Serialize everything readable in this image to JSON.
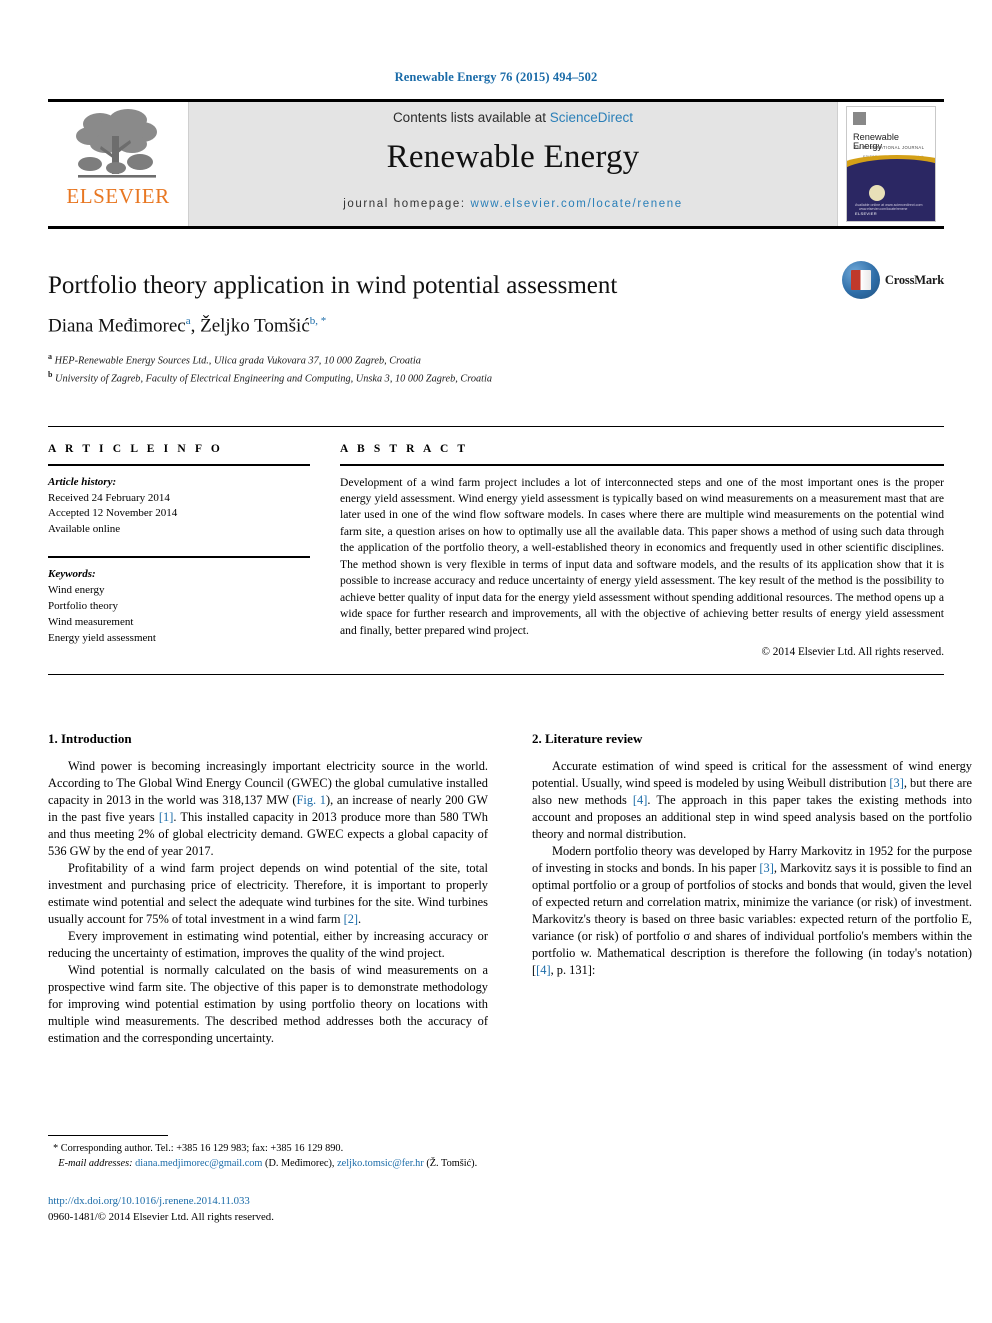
{
  "running_head": "Renewable Energy 76 (2015) 494–502",
  "masthead": {
    "publisher_name": "ELSEVIER",
    "contents_prefix": "Contents lists available at ",
    "contents_link": "ScienceDirect",
    "journal_name": "Renewable Energy",
    "homepage_prefix": "journal homepage: ",
    "homepage_url": "www.elsevier.com/locate/renene",
    "cover": {
      "title": "Renewable Energy",
      "subtitle": "AN INTERNATIONAL JOURNAL",
      "subtitle2": "EDITOR-IN-CHIEF: A.A.M. Sayigh",
      "footer": "ELSEVIER",
      "footer2": "Available online at www.sciencedirect.com",
      "mid": "www.elsevier.com/locate/renene"
    }
  },
  "article": {
    "title": "Portfolio theory application in wind potential assessment",
    "authors": [
      {
        "name": "Diana Međimorec",
        "marks": "a"
      },
      {
        "name": "Željko Tomšić",
        "marks": "b, *"
      }
    ],
    "authors_line_sep": ", ",
    "affiliations": [
      {
        "mark": "a",
        "text": "HEP-Renewable Energy Sources Ltd., Ulica grada Vukovara 37, 10 000 Zagreb, Croatia"
      },
      {
        "mark": "b",
        "text": "University of Zagreb, Faculty of Electrical Engineering and Computing, Unska 3, 10 000 Zagreb, Croatia"
      }
    ],
    "crossmark_label": "CrossMark"
  },
  "info": {
    "heading": "A R T I C L E   I N F O",
    "history_label": "Article history:",
    "history": [
      "Received 24 February 2014",
      "Accepted 12 November 2014",
      "Available online"
    ],
    "keywords_label": "Keywords:",
    "keywords": [
      "Wind energy",
      "Portfolio theory",
      "Wind measurement",
      "Energy yield assessment"
    ]
  },
  "abstract": {
    "heading": "A B S T R A C T",
    "text": "Development of a wind farm project includes a lot of interconnected steps and one of the most important ones is the proper energy yield assessment. Wind energy yield assessment is typically based on wind measurements on a measurement mast that are later used in one of the wind flow software models. In cases where there are multiple wind measurements on the potential wind farm site, a question arises on how to optimally use all the available data. This paper shows a method of using such data through the application of the portfolio theory, a well-established theory in economics and frequently used in other scientific disciplines. The method shown is very flexible in terms of input data and software models, and the results of its application show that it is possible to increase accuracy and reduce uncertainty of energy yield assessment. The key result of the method is the possibility to achieve better quality of input data for the energy yield assessment without spending additional resources. The method opens up a wide space for further research and improvements, all with the objective of achieving better results of energy yield assessment and finally, better prepared wind project.",
    "copyright": "© 2014 Elsevier Ltd. All rights reserved."
  },
  "sections": {
    "intro": {
      "heading": "1. Introduction",
      "p1_a": "Wind power is becoming increasingly important electricity source in the world. According to The Global Wind Energy Council (GWEC) the global cumulative installed capacity in 2013 in the world was 318,137 MW (",
      "p1_fig": "Fig. 1",
      "p1_b": "), an increase of nearly 200 GW in the past five years ",
      "p1_ref1": "[1]",
      "p1_c": ". This installed capacity in 2013 produce more than 580 TWh and thus meeting 2% of global electricity demand. GWEC expects a global capacity of 536 GW by the end of year 2017.",
      "p2_a": "Profitability of a wind farm project depends on wind potential of the site, total investment and purchasing price of electricity. Therefore, it is important to properly estimate wind potential and select the adequate wind turbines for the site. Wind turbines usually account for 75% of total investment in a wind farm ",
      "p2_ref": "[2]",
      "p2_b": ".",
      "p3": "Every improvement in estimating wind potential, either by increasing accuracy or reducing the uncertainty of estimation, improves the quality of the wind project.",
      "p4": "Wind potential is normally calculated on the basis of wind measurements on a prospective wind farm site. The objective of this paper is to demonstrate methodology for improving wind potential estimation by using portfolio theory on locations with multiple wind measurements. The described method addresses both the accuracy of estimation and the corresponding uncertainty."
    },
    "literature": {
      "heading": "2. Literature review",
      "p1_a": "Accurate estimation of wind speed is critical for the assessment of wind energy potential. Usually, wind speed is modeled by using Weibull distribution ",
      "p1_ref1": "[3]",
      "p1_b": ", but there are also new methods ",
      "p1_ref2": "[4]",
      "p1_c": ". The approach in this paper takes the existing methods into account and proposes an additional step in wind speed analysis based on the portfolio theory and normal distribution.",
      "p2_a": "Modern portfolio theory was developed by Harry Markovitz in 1952 for the purpose of investing in stocks and bonds. In his paper ",
      "p2_ref1": "[3]",
      "p2_b": ", Markovitz says it is possible to find an optimal portfolio or a group of portfolios of stocks and bonds that would, given the level of expected return and correlation matrix, minimize the variance (or risk) of investment. Markovitz's theory is based on three basic variables: expected return of the portfolio E, variance (or risk) of portfolio σ and shares of individual portfolio's members within the portfolio w. Mathematical description is therefore the following (in today's notation) [",
      "p2_ref2": "[4]",
      "p2_c": ", p. 131]:"
    }
  },
  "footnotes": {
    "corresponding_star": "*",
    "corresponding": "Corresponding author. Tel.: +385 16 129 983; fax: +385 16 129 890.",
    "email_label": "E-mail addresses:",
    "email1": "diana.medjimorec@gmail.com",
    "email1_owner": " (D. Međimorec), ",
    "email2": "zeljko.tomsic@fer.hr",
    "email2_owner": " (Ž. Tomšić)."
  },
  "doi": {
    "link": "http://dx.doi.org/10.1016/j.renene.2014.11.033",
    "issn_line": "0960-1481/© 2014 Elsevier Ltd. All rights reserved."
  },
  "colors": {
    "link_blue": "#1a6ba8",
    "elsevier_orange": "#E87722",
    "masthead_grey": "#e4e4e4",
    "cover_navy": "#2b2763",
    "cover_gold": "#d4a017"
  }
}
